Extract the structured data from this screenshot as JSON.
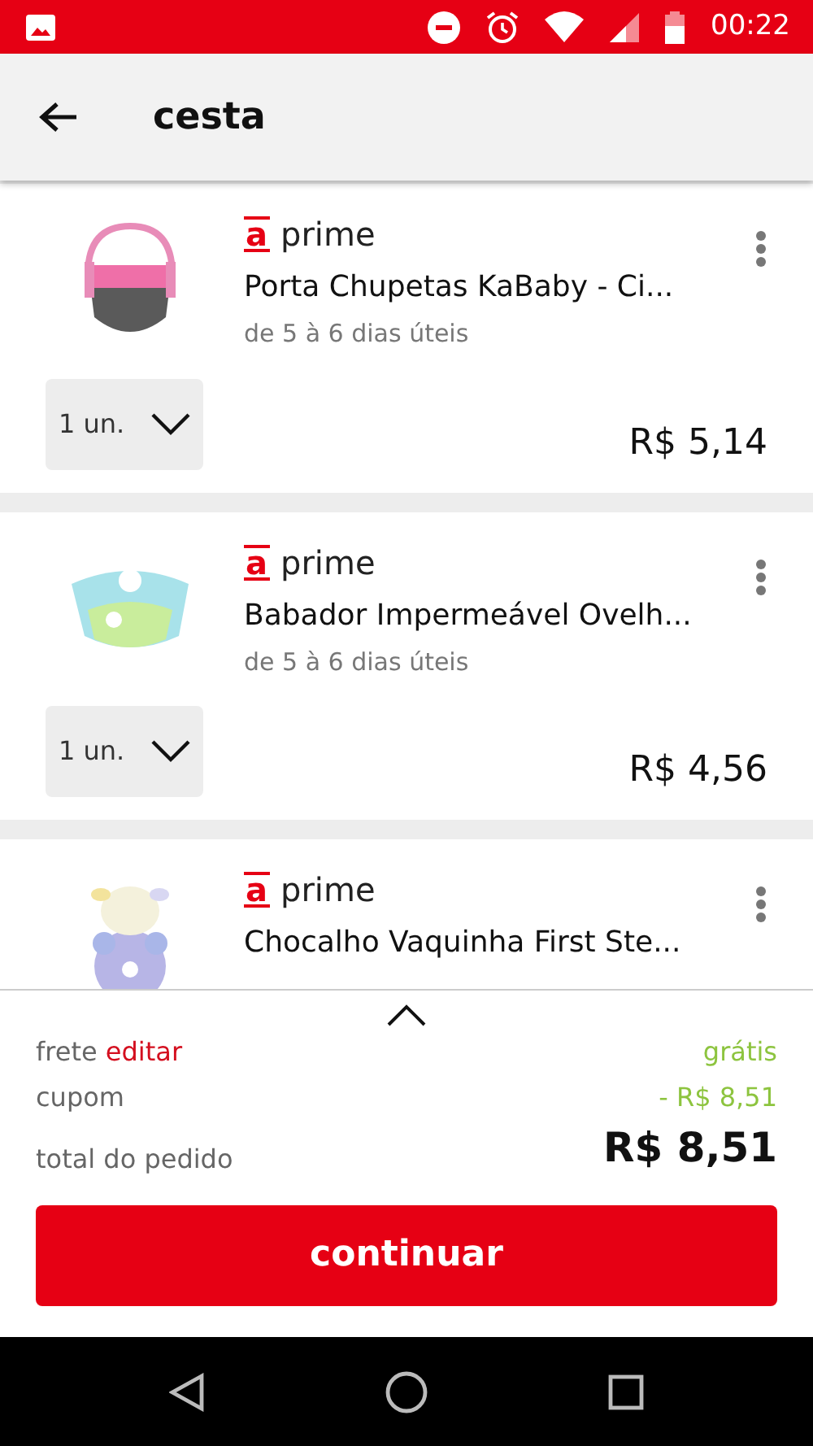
{
  "status_bar": {
    "time": "00:22"
  },
  "header": {
    "title": "cesta"
  },
  "items": [
    {
      "logo": "a",
      "tag": "prime",
      "name": "Porta Chupetas KaBaby - Ci...",
      "delivery": "de 5 à 6 dias úteis",
      "quantity": "1 un.",
      "price": "R$ 5,14"
    },
    {
      "logo": "a",
      "tag": "prime",
      "name": "Babador Impermeável Ovelh...",
      "delivery": "de 5 à 6 dias úteis",
      "quantity": "1 un.",
      "price": "R$ 4,56"
    },
    {
      "logo": "a",
      "tag": "prime",
      "name": "Chocalho Vaquinha First Ste..."
    }
  ],
  "summary": {
    "shipping": {
      "label": "frete",
      "link": "editar",
      "value": "grátis"
    },
    "coupon": {
      "label": "cupom",
      "value": "- R$ 8,51"
    },
    "total": {
      "label": "total do pedido",
      "value": "R$ 8,51"
    }
  },
  "button": "continuar"
}
